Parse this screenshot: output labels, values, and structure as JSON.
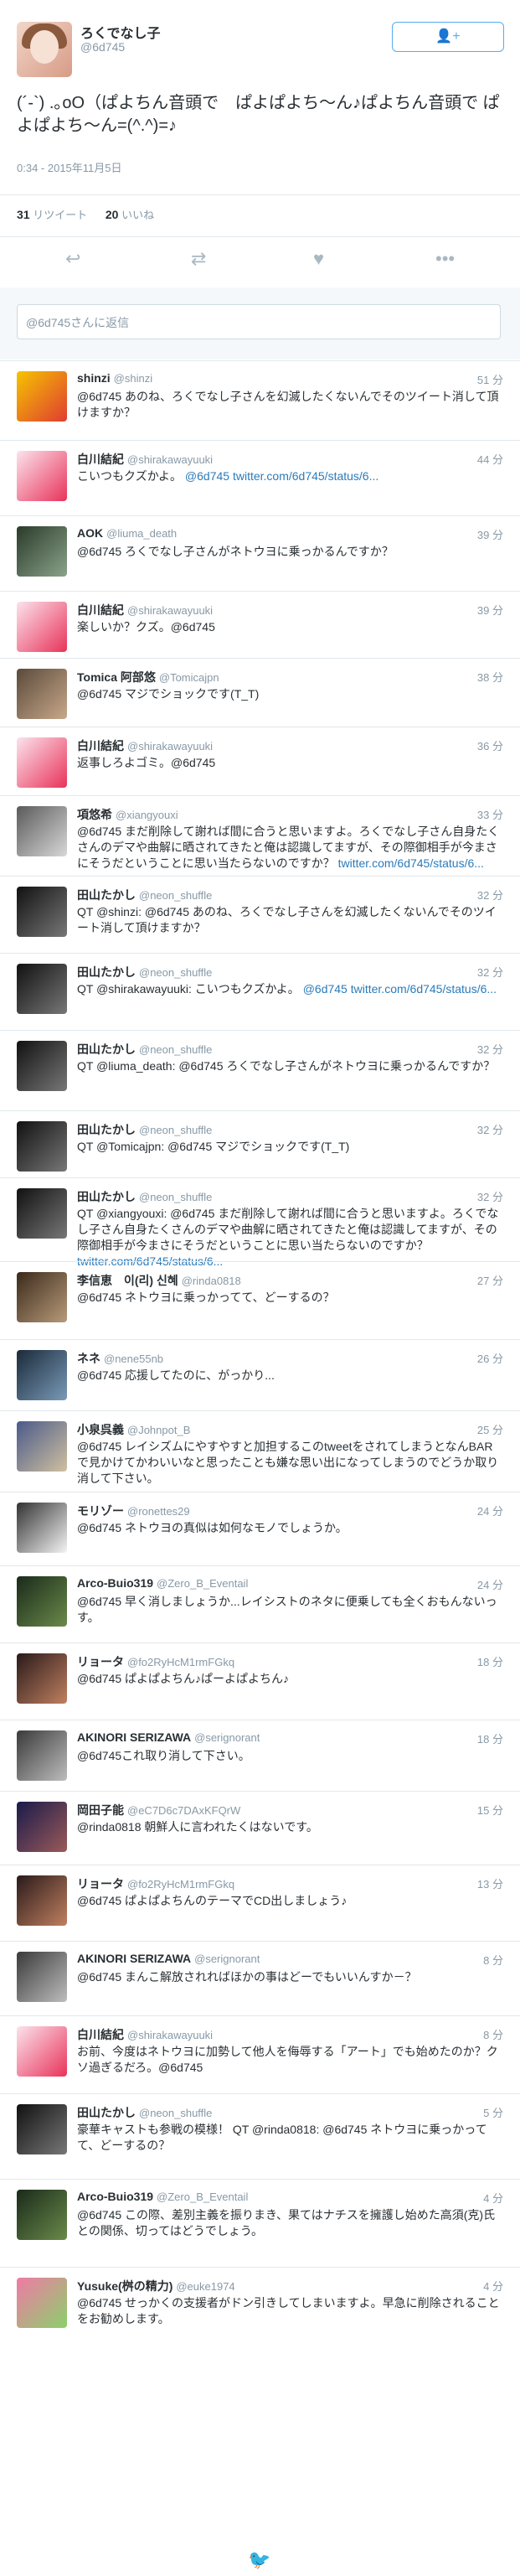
{
  "header": {
    "display_name": "ろくでなし子",
    "screen_name": "@6d745",
    "follow_label": "👤+"
  },
  "tweet": {
    "text": "(´-`) .｡oO（ぱよちん音頭で　ぱよぱよち〜ん♪ぱよちん音頭で ぱよぱよち〜ん=(^.^)=♪",
    "timestamp": "0:34 - 2015年11月5日",
    "retweets": "31",
    "retweets_label": "リツイート",
    "likes": "20",
    "likes_label": "いいね"
  },
  "actions": {
    "reply_icon": "reply-icon",
    "retweet_icon": "retweet-icon",
    "like_icon": "heart-icon",
    "more_icon": "more-icon"
  },
  "reply_box": {
    "placeholder": "@6d745さんに返信"
  },
  "replies": [
    {
      "name": "shinzi",
      "handle": "@shinzi",
      "time": "51 分",
      "text": "@6d745 あのね、ろくでなし子さんを幻滅したくないんでそのツイート消して頂けますか？",
      "link": ""
    },
    {
      "name": "白川結紀",
      "handle": "@shirakawayuuki",
      "time": "44 分",
      "text": "こいつもクズかよ。",
      "link": "@6d745 twitter.com/6d745/status/6..."
    },
    {
      "name": "AOK",
      "handle": "@liuma_death",
      "time": "39 分",
      "text": "@6d745 ろくでなし子さんがネトウヨに乗っかるんですか？",
      "link": ""
    },
    {
      "name": "白川結紀",
      "handle": "@shirakawayuuki",
      "time": "39 分",
      "text": "楽しいか？クズ。@6d745",
      "link": ""
    },
    {
      "name": "Tomica 阿部悠",
      "handle": "@Tomicajpn",
      "time": "38 分",
      "text": "@6d745 マジでショックです(T_T)",
      "link": ""
    },
    {
      "name": "白川結紀",
      "handle": "@shirakawayuuki",
      "time": "36 分",
      "text": "返事しろよゴミ。@6d745",
      "link": ""
    },
    {
      "name": "項悠希",
      "handle": "@xiangyouxi",
      "time": "33 分",
      "text": "@6d745 まだ削除して謝れば間に合うと思いますよ。ろくでなし子さん自身たくさんのデマや曲解に晒されてきたと俺は認識してますが、その際御相手が今まさにそうだということに思い当たらないのですか？",
      "link": "twitter.com/6d745/status/6..."
    },
    {
      "name": "田山たかし",
      "handle": "@neon_shuffle",
      "time": "32 分",
      "text": "QT @shinzi: @6d745 あのね、ろくでなし子さんを幻滅したくないんでそのツイート消して頂けますか？",
      "link": ""
    },
    {
      "name": "田山たかし",
      "handle": "@neon_shuffle",
      "time": "32 分",
      "text": "QT @shirakawayuuki: こいつもクズかよ。",
      "link": "@6d745 twitter.com/6d745/status/6..."
    },
    {
      "name": "田山たかし",
      "handle": "@neon_shuffle",
      "time": "32 分",
      "text": "QT @liuma_death: @6d745 ろくでなし子さんがネトウヨに乗っかるんですか？",
      "link": ""
    },
    {
      "name": "田山たかし",
      "handle": "@neon_shuffle",
      "time": "32 分",
      "text": "QT @Tomicajpn: @6d745 マジでショックです(T_T)",
      "link": ""
    },
    {
      "name": "田山たかし",
      "handle": "@neon_shuffle",
      "time": "32 分",
      "text": "QT @xiangyouxi: @6d745 まだ削除して謝れば間に合うと思いますよ。ろくでなし子さん自身たくさんのデマや曲解に晒されてきたと俺は認識してますが、その際御相手が今まさにそうだということに思い当たらないのですか？",
      "link": "twitter.com/6d745/status/6..."
    },
    {
      "name": "李信恵　이(리) 신혜",
      "handle": "@rinda0818",
      "time": "27 分",
      "text": "@6d745 ネトウヨに乗っかってて、どーするの？",
      "link": ""
    },
    {
      "name": "ネネ",
      "handle": "@nene55nb",
      "time": "26 分",
      "text": "@6d745 応援してたのに、がっかり...",
      "link": ""
    },
    {
      "name": "小泉呉義",
      "handle": "@Johnpot_B",
      "time": "25 分",
      "text": "@6d745 レイシズムにやすやすと加担するこのtweetをされてしまうとなんBARで見かけてかわいいなと思ったことも嫌な思い出になってしまうのでどうか取り消して下さい。",
      "link": ""
    },
    {
      "name": "モリゾー",
      "handle": "@ronettes29",
      "time": "24 分",
      "text": "@6d745 ネトウヨの真似は如何なモノでしょうか。",
      "link": ""
    },
    {
      "name": "Arco-Buio319",
      "handle": "@Zero_B_Eventail",
      "time": "24 分",
      "text": "@6d745 早く消しましょうか...レイシストのネタに便乗しても全くおもんないっす。",
      "link": ""
    },
    {
      "name": "リョータ",
      "handle": "@fo2RyHcM1rmFGkq",
      "time": "18 分",
      "text": "@6d745 ぱよぱよちん♪ぱーよぱよちん♪",
      "link": ""
    },
    {
      "name": "AKINORI SERIZAWA",
      "handle": "@serignorant",
      "time": "18 分",
      "text": "@6d745これ取り消して下さい。",
      "link": ""
    },
    {
      "name": "岡田子能",
      "handle": "@eC7D6c7DAxKFQrW",
      "time": "15 分",
      "text": "@rinda0818 朝鮮人に言われたくはないです。",
      "link": ""
    },
    {
      "name": "リョータ",
      "handle": "@fo2RyHcM1rmFGkq",
      "time": "13 分",
      "text": "@6d745 ぱよぱよちんのテーマでCD出しましょう♪",
      "link": ""
    },
    {
      "name": "AKINORI SERIZAWA",
      "handle": "@serignorant",
      "time": "8 分",
      "text": "@6d745 まんこ解放されればほかの事はどーでもいいんすか－？",
      "link": ""
    },
    {
      "name": "白川結紀",
      "handle": "@shirakawayuuki",
      "time": "8 分",
      "text": "お前、今度はネトウヨに加勢して他人を侮辱する「アート」でも始めたのか？クソ過ぎるだろ。@6d745",
      "link": ""
    },
    {
      "name": "田山たかし",
      "handle": "@neon_shuffle",
      "time": "5 分",
      "text": "豪華キャストも参戦の模様！ QT @rinda0818: @6d745 ネトウヨに乗っかってて、どーするの？",
      "link": ""
    },
    {
      "name": "Arco-Buio319",
      "handle": "@Zero_B_Eventail",
      "time": "4 分",
      "text": "@6d745 この際、差別主義を振りまき、果てはナチスを擁護し始めた高須(克)氏との関係、切ってはどうでしょう。",
      "link": ""
    },
    {
      "name": "Yusuke(桝の精力)",
      "handle": "@euke1974",
      "time": "4 分",
      "text": "@6d745 せっかくの支援者がドン引きしてしまいますよ。早急に削除されることをお勧めします。",
      "link": ""
    }
  ],
  "footer": {
    "icon": "twitter-bird-icon"
  }
}
